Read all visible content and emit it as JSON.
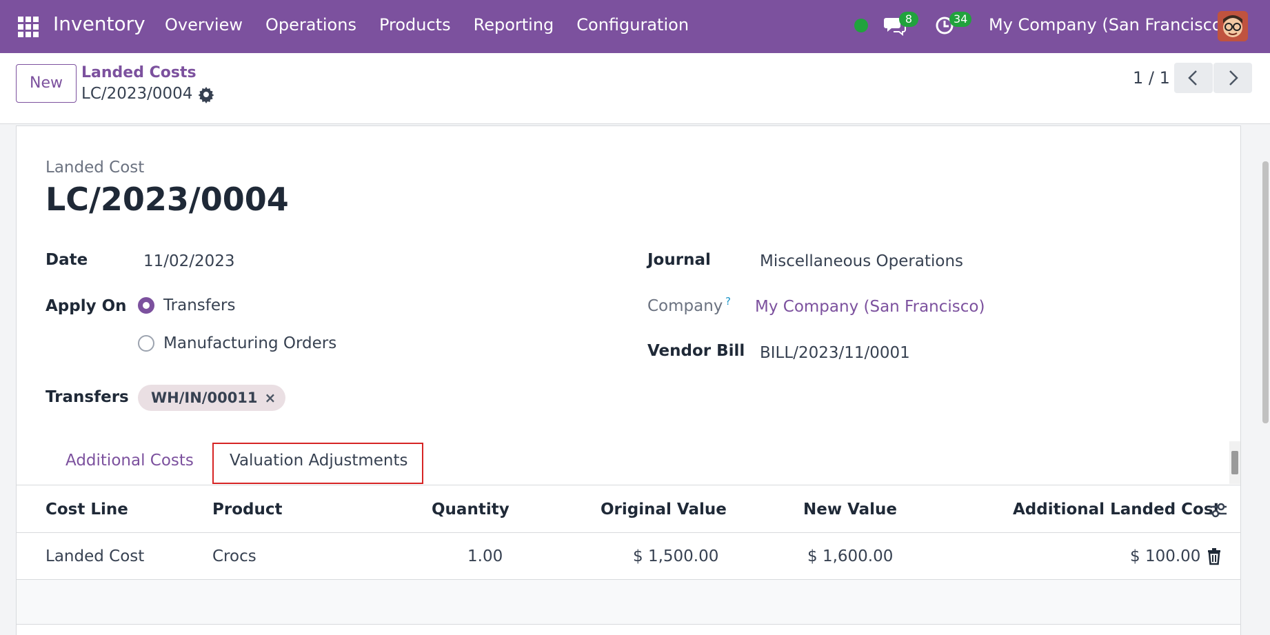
{
  "nav": {
    "app_name": "Inventory",
    "menu": [
      "Overview",
      "Operations",
      "Products",
      "Reporting",
      "Configuration"
    ],
    "chat_count": "8",
    "activity_count": "34",
    "company": "My Company (San Francisco)",
    "colors": {
      "brand": "#7c519e",
      "badge": "#21a23d"
    },
    "icons": [
      "apps-icon",
      "status-dot-icon",
      "chat-icon",
      "activity-clock-icon",
      "user-avatar"
    ]
  },
  "control": {
    "new_label": "New",
    "breadcrumb_parent": "Landed Costs",
    "breadcrumb_current": "LC/2023/0004",
    "pager": "1 / 1"
  },
  "form": {
    "small_label": "Landed Cost",
    "title": "LC/2023/0004",
    "date_label": "Date",
    "date_value": "11/02/2023",
    "apply_on_label": "Apply On",
    "apply_on_options": [
      "Transfers",
      "Manufacturing Orders"
    ],
    "apply_on_selected": "Transfers",
    "transfers_label": "Transfers",
    "transfer_tag": "WH/IN/00011",
    "journal_label": "Journal",
    "journal_value": "Miscellaneous Operations",
    "company_label": "Company",
    "company_help": "?",
    "company_value": "My Company (San Francisco)",
    "vendor_bill_label": "Vendor Bill",
    "vendor_bill_value": "BILL/2023/11/0001"
  },
  "tabs": [
    {
      "label": "Additional Costs",
      "active": false
    },
    {
      "label": "Valuation Adjustments",
      "active": true
    }
  ],
  "table": {
    "columns": [
      "Cost Line",
      "Product",
      "Quantity",
      "Original Value",
      "New Value",
      "Additional Landed Cost"
    ],
    "rows": [
      [
        "Landed Cost",
        "Crocs",
        "1.00",
        "$ 1,500.00",
        "$ 1,600.00",
        "$ 100.00"
      ]
    ]
  }
}
